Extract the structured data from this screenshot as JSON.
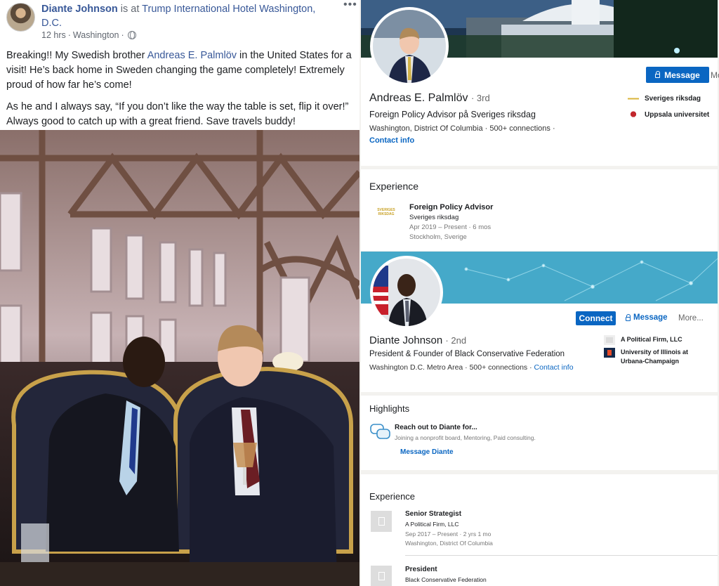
{
  "facebook": {
    "author": "Diante Johnson",
    "is_at": "is at",
    "place": "Trump International Hotel Washington, D.C.",
    "time": "12 hrs",
    "location": "Washington",
    "sep": "·",
    "menu": "•••",
    "p1_a": "Breaking!! My Swedish brother ",
    "p1_mention": "Andreas E. Palmlöv",
    "p1_b": " in the United States for a visit! He’s back home in Sweden changing the game completely! Extremely proud of how far he’s come!",
    "p2": "As he and I always say, “If you don’t like the way the table is set, flip it over!” Always good to catch up with a great friend. Save travels buddy!"
  },
  "andreas": {
    "message_btn": "Message",
    "more_btn": "Mo",
    "name": "Andreas E. Palmlöv",
    "degree": "· 3rd",
    "headline": "Foreign Policy Advisor på Sveriges riksdag",
    "location_line": "Washington, District Of Columbia  ·  500+ connections  ·",
    "contact": "Contact info",
    "org1": "Sveriges riksdag",
    "org2": "Uppsala universitet",
    "exp_heading": "Experience",
    "exp_logo_text": "SVERIGES RIKSDAG",
    "exp_title": "Foreign Policy Advisor",
    "exp_company": "Sveriges riksdag",
    "exp_dates": "Apr 2019 – Present  ·  6 mos",
    "exp_place": "Stockholm, Sverige"
  },
  "diante": {
    "connect_btn": "Connect",
    "message_btn": "Message",
    "more_btn": "More...",
    "name": "Diante Johnson",
    "degree": "· 2nd",
    "headline": "President & Founder of Black Conservative Federation",
    "location_line": "Washington D.C. Metro Area  ·  500+ connections  ·",
    "contact": "Contact info",
    "org1": "A Political Firm, LLC",
    "org2": "University of Illinois at Urbana-Champaign",
    "highlights_heading": "Highlights",
    "hl_title": "Reach out to Diante for...",
    "hl_sub": "Joining a nonprofit board, Mentoring, Paid consulting.",
    "hl_link": "Message Diante",
    "exp_heading": "Experience",
    "exp1_title": "Senior Strategist",
    "exp1_company": "A Political Firm, LLC",
    "exp1_dates": "Sep 2017 – Present  ·  2 yrs 1 mo",
    "exp1_place": "Washington, District Of Columbia",
    "exp2_title": "President",
    "exp2_company": "Black Conservative Federation"
  }
}
